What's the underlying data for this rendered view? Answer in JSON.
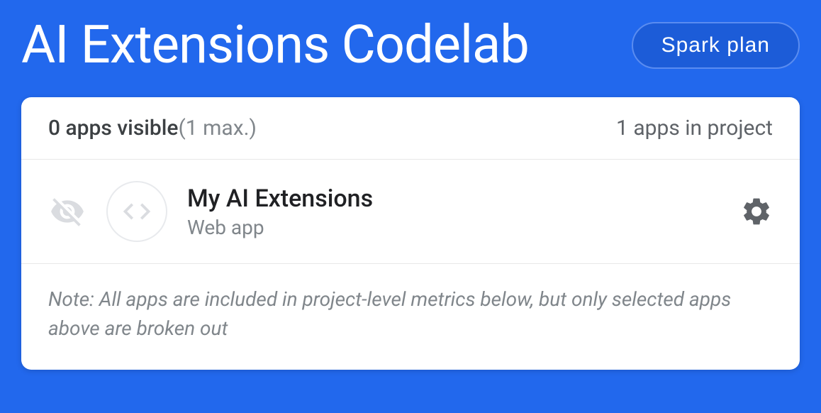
{
  "header": {
    "title": "AI Extensions Codelab",
    "plan_label": "Spark plan"
  },
  "card": {
    "apps_visible_count": "0 apps visible",
    "apps_visible_max": "(1 max.)",
    "apps_in_project": "1 apps in project",
    "app": {
      "name": "My AI Extensions",
      "type": "Web app"
    },
    "note": "Note: All apps are included in project-level metrics below, but only selected apps above are broken out"
  },
  "colors": {
    "background": "#2268ed",
    "card_bg": "#ffffff",
    "text_primary": "#202124",
    "text_secondary": "#5f6368",
    "text_muted": "#80868b",
    "icon_muted": "#dadce0"
  }
}
